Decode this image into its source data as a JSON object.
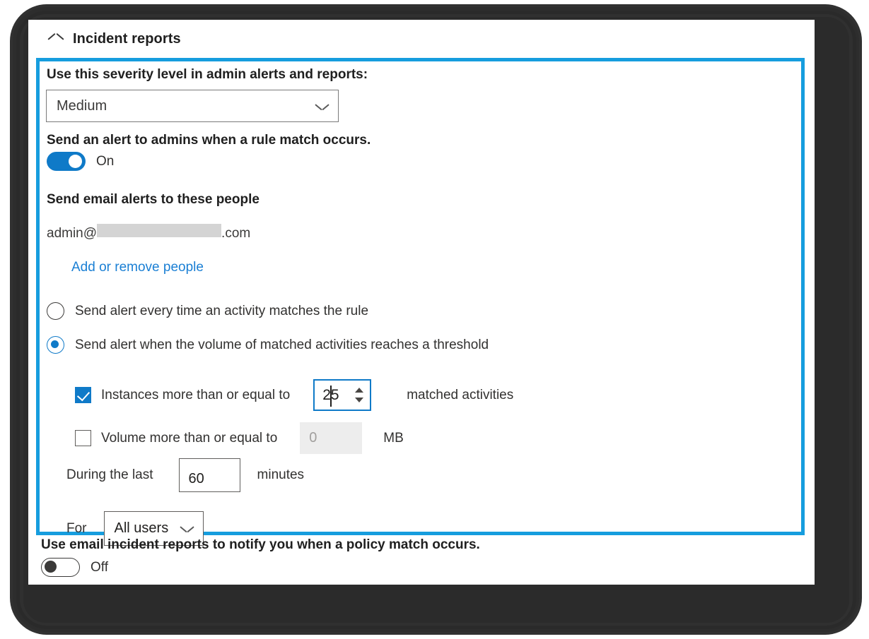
{
  "section": {
    "title": "Incident reports",
    "collapse_icon": "chevron-up-icon"
  },
  "severity": {
    "label": "Use this severity level in admin alerts and reports:",
    "selected": "Medium",
    "dropdown_icon": "chevron-down-icon"
  },
  "admin_alert": {
    "label": "Send an alert to admins when a rule match occurs.",
    "toggle_state": "On"
  },
  "email_recipients": {
    "label": "Send email alerts to these people",
    "value_prefix": "admin@",
    "value_redacted": true,
    "value_suffix": ".com",
    "add_remove_link": "Add or remove people"
  },
  "alert_mode": {
    "option_every_time": "Send alert every time an activity matches the rule",
    "option_threshold": "Send alert when the volume of matched activities reaches a threshold",
    "selected": "threshold"
  },
  "threshold": {
    "instances": {
      "checked": true,
      "label": "Instances more than or equal to",
      "value": "25",
      "suffix": "matched activities",
      "spinner_up_icon": "triangle-up-icon",
      "spinner_down_icon": "triangle-down-icon"
    },
    "volume": {
      "checked": false,
      "label": "Volume more than or equal to",
      "value": "0",
      "suffix": "MB",
      "disabled": true
    },
    "duration": {
      "label": "During the last",
      "value": "60",
      "suffix": "minutes"
    },
    "scope": {
      "label": "For",
      "selected": "All users",
      "dropdown_icon": "chevron-down-icon"
    }
  },
  "incident_email": {
    "label": "Use email incident reports to notify you when a policy match occurs.",
    "toggle_state": "Off"
  },
  "colors": {
    "highlight_border": "#169dde",
    "accent_blue": "#0f7ac8",
    "link_blue": "#1a7fd4",
    "frame_dark": "#2b2b2b",
    "disabled_bg": "#ededed"
  }
}
